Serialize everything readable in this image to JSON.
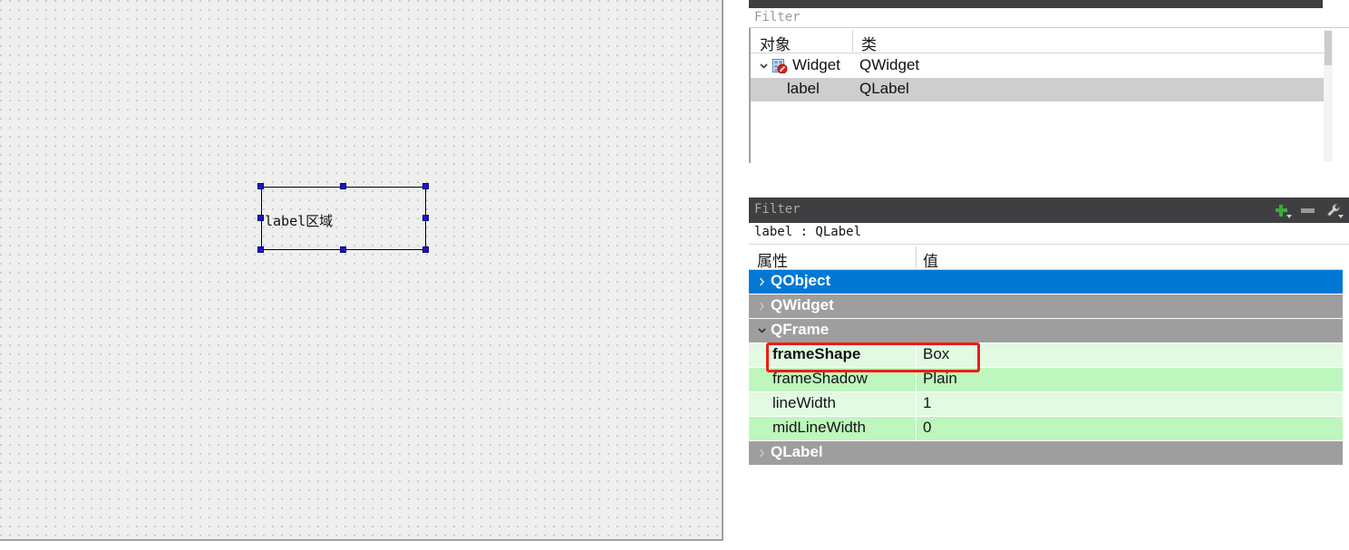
{
  "canvas": {
    "widget_label_text": "label区域"
  },
  "object_inspector": {
    "filter_placeholder": "Filter",
    "columns": [
      "对象",
      "类"
    ],
    "rows": [
      {
        "name": "Widget",
        "class": "QWidget",
        "icon": "widget-icon",
        "expanded": true,
        "selected": false
      },
      {
        "name": "label",
        "class": "QLabel",
        "icon": "",
        "expanded": false,
        "selected": true
      }
    ]
  },
  "property_editor": {
    "filter_placeholder": "Filter",
    "tools": [
      {
        "name": "add-property-button",
        "label": "+"
      },
      {
        "name": "remove-property-button",
        "label": "−"
      },
      {
        "name": "configure-button",
        "label": "wrench"
      }
    ],
    "object_line": "label : QLabel",
    "columns": [
      "属性",
      "值"
    ],
    "rows": [
      {
        "kind": "group",
        "name": "QObject",
        "value": "",
        "expanded": false,
        "selected": true
      },
      {
        "kind": "group",
        "name": "QWidget",
        "value": "",
        "expanded": false,
        "selected": false
      },
      {
        "kind": "group",
        "name": "QFrame",
        "value": "",
        "expanded": true,
        "selected": false
      },
      {
        "kind": "prop",
        "name": "frameShape",
        "value": "Box",
        "bold": true,
        "shade": "a",
        "highlighted": true
      },
      {
        "kind": "prop",
        "name": "frameShadow",
        "value": "Plain",
        "bold": false,
        "shade": "b",
        "highlighted": false
      },
      {
        "kind": "prop",
        "name": "lineWidth",
        "value": "1",
        "bold": false,
        "shade": "a",
        "highlighted": false
      },
      {
        "kind": "prop",
        "name": "midLineWidth",
        "value": "0",
        "bold": false,
        "shade": "b",
        "highlighted": false
      },
      {
        "kind": "group",
        "name": "QLabel",
        "value": "",
        "expanded": false,
        "selected": false
      }
    ]
  },
  "colors": {
    "selected_row": "#0078d4",
    "group_row": "#9e9e9e",
    "prop_row_light": "#e1fae1",
    "prop_row_dark": "#bdf7bd",
    "highlight_outline": "#ee1c16",
    "canvas_background": "#efefef",
    "titlebar": "#3f3f42"
  }
}
